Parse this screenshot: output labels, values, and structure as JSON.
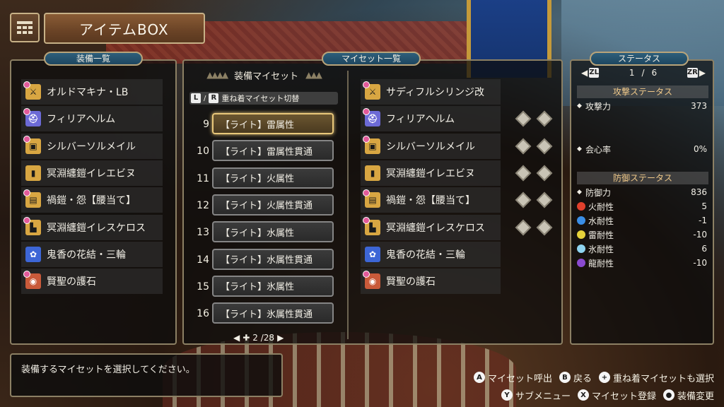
{
  "header": {
    "title": "アイテムBOX"
  },
  "left_panel": {
    "tab": "装備一覧",
    "items": [
      {
        "type": "weapon",
        "label": "オルドマキナ・LB"
      },
      {
        "type": "helm",
        "label": "フィリアヘルム"
      },
      {
        "type": "chest",
        "label": "シルバーソルメイル"
      },
      {
        "type": "arm",
        "label": "冥淵纏鎧イレエビヌ"
      },
      {
        "type": "waist",
        "label": "禍鎧・怨【腰当て】"
      },
      {
        "type": "leg",
        "label": "冥淵纏鎧イレスケロス"
      },
      {
        "type": "charm",
        "label": "鬼香の花結・三輪"
      },
      {
        "type": "talisman",
        "label": "賢聖の護石"
      }
    ]
  },
  "myset_panel": {
    "tab": "マイセット一覧",
    "heading": "装備マイセット",
    "switch_hint": "重ね着マイセット切替",
    "switch_keys": [
      "L",
      "R"
    ],
    "sets": [
      {
        "num": "9",
        "label": "【ライト】雷属性",
        "selected": true
      },
      {
        "num": "10",
        "label": "【ライト】雷属性貫通",
        "selected": false
      },
      {
        "num": "11",
        "label": "【ライト】火属性",
        "selected": false
      },
      {
        "num": "12",
        "label": "【ライト】火属性貫通",
        "selected": false
      },
      {
        "num": "13",
        "label": "【ライト】水属性",
        "selected": false
      },
      {
        "num": "14",
        "label": "【ライト】水属性貫通",
        "selected": false
      },
      {
        "num": "15",
        "label": "【ライト】氷属性",
        "selected": false
      },
      {
        "num": "16",
        "label": "【ライト】氷属性貫通",
        "selected": false
      }
    ],
    "pager": "2 /28",
    "set_items": [
      {
        "type": "weapon",
        "label": "サディフルシリンジ改",
        "slots": 0
      },
      {
        "type": "helm",
        "label": "フィリアヘルム",
        "slots": 2
      },
      {
        "type": "chest",
        "label": "シルバーソルメイル",
        "slots": 2
      },
      {
        "type": "arm",
        "label": "冥淵纏鎧イレエビヌ",
        "slots": 2
      },
      {
        "type": "waist",
        "label": "禍鎧・怨【腰当て】",
        "slots": 2
      },
      {
        "type": "leg",
        "label": "冥淵纏鎧イレスケロス",
        "slots": 2
      },
      {
        "type": "charm",
        "label": "鬼香の花結・三輪",
        "slots": 0
      },
      {
        "type": "talisman",
        "label": "賢聖の護石",
        "slots": 0
      }
    ]
  },
  "status_panel": {
    "tab": "ステータス",
    "page_left_key": "ZL",
    "page_right_key": "ZR",
    "page": "1",
    "page_sep": "/",
    "page_total": "6",
    "attack_heading": "攻撃ステータス",
    "attack_label": "攻撃力",
    "attack_value": "373",
    "affinity_label": "会心率",
    "affinity_value": "0%",
    "defense_heading": "防御ステータス",
    "defense_label": "防御力",
    "defense_value": "836",
    "resistances": [
      {
        "label": "火耐性",
        "value": "5",
        "color": "#e0402c"
      },
      {
        "label": "水耐性",
        "value": "-1",
        "color": "#3a8ee6"
      },
      {
        "label": "雷耐性",
        "value": "-10",
        "color": "#e6d23a"
      },
      {
        "label": "氷耐性",
        "value": "6",
        "color": "#8fd4f0"
      },
      {
        "label": "龍耐性",
        "value": "-10",
        "color": "#8a4ad0"
      }
    ]
  },
  "message": "装備するマイセットを選択してください。",
  "help": {
    "row1": [
      {
        "key": "A",
        "label": "マイセット呼出"
      },
      {
        "key": "B",
        "label": "戻る"
      },
      {
        "key": "+",
        "label": "重ね着マイセットも選択"
      }
    ],
    "row2": [
      {
        "key": "Y",
        "label": "サブメニュー"
      },
      {
        "key": "X",
        "label": "マイセット登録"
      },
      {
        "key": "●",
        "label": "装備変更"
      }
    ]
  }
}
